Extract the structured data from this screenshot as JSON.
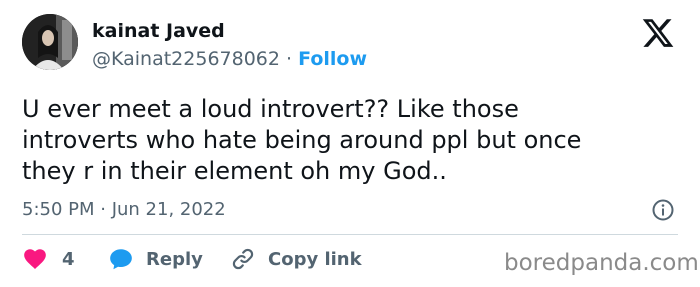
{
  "tweet": {
    "author_name": "kainat Javed",
    "handle": "@Kainat225678062",
    "separator": "·",
    "follow_label": "Follow",
    "text_lines": [
      "U ever meet a loud introvert?? Like those",
      "introverts who hate being around ppl but once",
      "they r in their element oh my God.."
    ],
    "timestamp": "5:50 PM · Jun 21, 2022"
  },
  "actions": {
    "likes_count": "4",
    "reply_label": "Reply",
    "copy_link_label": "Copy link"
  },
  "watermark": "boredpanda.com",
  "icons": {
    "platform_logo": "x-logo-icon",
    "info": "info-icon",
    "like": "heart-icon",
    "reply": "speech-bubble-icon",
    "copy_link": "link-icon"
  },
  "colors": {
    "text": "#0f1419",
    "secondary": "#536471",
    "accent": "#1d9bf0",
    "like": "#f91880",
    "divider": "#cfd9de",
    "watermark": "#8a8a8a"
  }
}
